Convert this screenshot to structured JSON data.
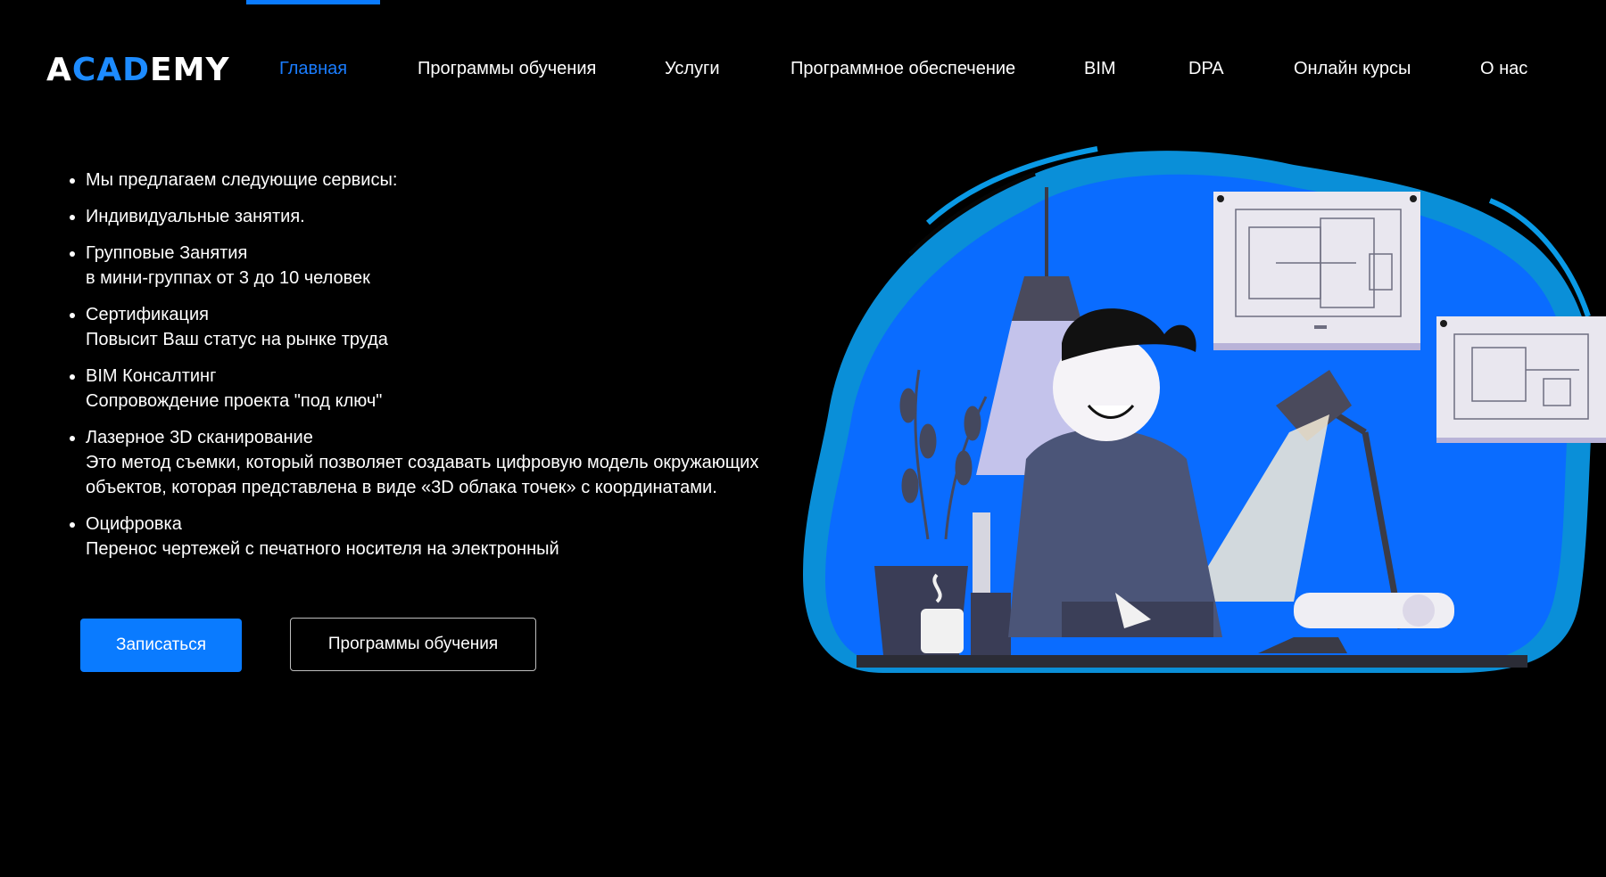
{
  "logo": {
    "text_part1": "A",
    "text_accent": "CAD",
    "text_part2": "EMY"
  },
  "nav": {
    "items": [
      {
        "label": "Главная",
        "active": true
      },
      {
        "label": "Программы обучения",
        "active": false
      },
      {
        "label": "Услуги",
        "active": false
      },
      {
        "label": "Программное обеспечение",
        "active": false
      },
      {
        "label": "BIM",
        "active": false
      },
      {
        "label": "DPA",
        "active": false
      },
      {
        "label": "Онлайн курсы",
        "active": false
      },
      {
        "label": "О нас",
        "active": false
      }
    ]
  },
  "services": {
    "items": [
      {
        "title": "Мы предлагаем следующие сервисы:",
        "text": ""
      },
      {
        "title": "Индивидуальные занятия.",
        "text": ""
      },
      {
        "title": "Групповые Занятия",
        "text": "в мини-группах от 3 до 10 человек"
      },
      {
        "title": "Сертификация",
        "text": "Повысит Ваш статус на рынке труда"
      },
      {
        "title": "BIM Консалтинг",
        "text": "Сопровождение проекта \"под ключ\""
      },
      {
        "title": "Лазерное 3D сканирование",
        "text": "Это метод съемки, который позволяет создавать цифровую модель окружающих объектов, которая представлена в виде «3D облака точек» с координатами."
      },
      {
        "title": "Оцифровка",
        "text": "Перенос чертежей с печатного носителя на электронный"
      }
    ]
  },
  "buttons": {
    "signup": "Записаться",
    "programs": "Программы обучения"
  },
  "colors": {
    "accent": "#0a7bff",
    "background": "#000000"
  },
  "illustration": {
    "icon": "student-drawing-illustration"
  }
}
